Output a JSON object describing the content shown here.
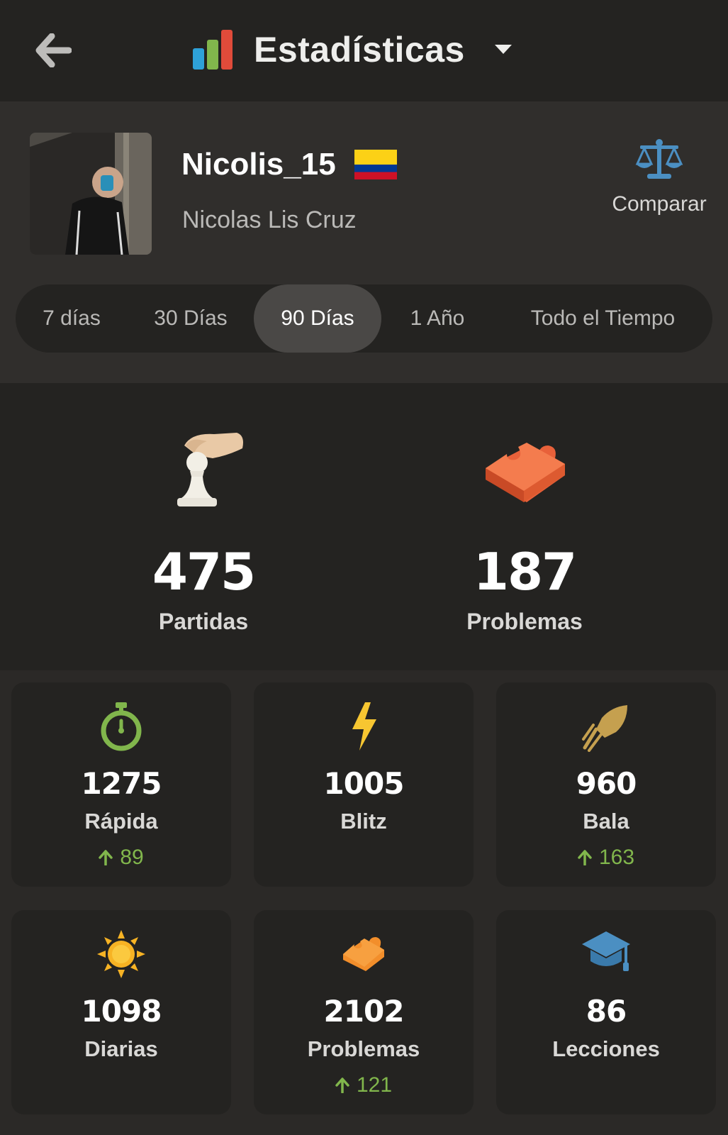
{
  "header": {
    "title": "Estadísticas"
  },
  "profile": {
    "username": "Nicolis_15",
    "full_name": "Nicolas Lis Cruz",
    "country_flag": "colombia",
    "compare_label": "Comparar"
  },
  "range_tabs": [
    {
      "label": "7 días",
      "active": false
    },
    {
      "label": "30 Días",
      "active": false
    },
    {
      "label": "90 Días",
      "active": true
    },
    {
      "label": "1 Año",
      "active": false
    },
    {
      "label": "Todo el Tiempo",
      "active": false
    }
  ],
  "summary": [
    {
      "icon": "pawn-hand-icon",
      "value": "475",
      "label": "Partidas"
    },
    {
      "icon": "puzzle-piece-icon",
      "value": "187",
      "label": "Problemas"
    }
  ],
  "cards": [
    {
      "icon": "stopwatch-icon",
      "value": "1275",
      "label": "Rápida",
      "delta": "89",
      "color": "#81b64c"
    },
    {
      "icon": "lightning-icon",
      "value": "1005",
      "label": "Blitz",
      "delta": "",
      "color": "#f7c631"
    },
    {
      "icon": "bullet-icon",
      "value": "960",
      "label": "Bala",
      "delta": "163",
      "color": "#c5a04f"
    },
    {
      "icon": "sun-icon",
      "value": "1098",
      "label": "Diarias",
      "delta": "",
      "color": "#f7b324"
    },
    {
      "icon": "puzzle-icon",
      "value": "2102",
      "label": "Problemas",
      "delta": "121",
      "color": "#f28e2b"
    },
    {
      "icon": "graduation-cap-icon",
      "value": "86",
      "label": "Lecciones",
      "delta": "",
      "color": "#4b8fc2"
    }
  ],
  "colors": {
    "accent_positive": "#81b64c",
    "header_bg": "#242321",
    "profile_bg": "#302e2c"
  }
}
